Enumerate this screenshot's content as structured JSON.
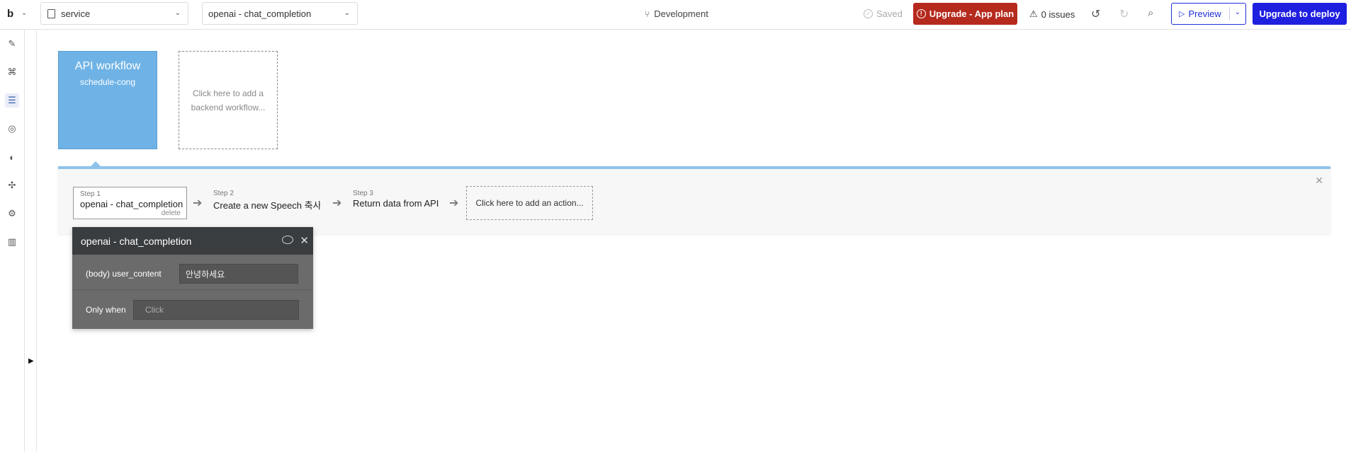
{
  "topbar": {
    "logo": "b",
    "page_dropdown": "service",
    "workflow_dropdown": "openai - chat_completion",
    "branch": "Development",
    "saved": "Saved",
    "upgrade_plan": "Upgrade - App plan",
    "issues": "0 issues",
    "preview": "Preview",
    "deploy": "Upgrade to deploy",
    "colors": {
      "upgrade_plan_bg": "#b52a1d",
      "deploy_bg": "#1f1fe0",
      "preview_border": "#1f2fd6"
    }
  },
  "sidebar": {
    "items": [
      {
        "icon": "pencil-icon",
        "glyph": "✎"
      },
      {
        "icon": "hierarchy-icon",
        "glyph": "⌘"
      },
      {
        "icon": "workflow-icon",
        "glyph": "☰"
      },
      {
        "icon": "database-icon",
        "glyph": "◎"
      },
      {
        "icon": "palette-icon",
        "glyph": "◐"
      },
      {
        "icon": "plugin-icon",
        "glyph": "✣"
      },
      {
        "icon": "settings-icon",
        "glyph": "⚙"
      },
      {
        "icon": "logs-icon",
        "glyph": "▥"
      }
    ]
  },
  "canvas": {
    "workflow_card": {
      "title": "API workflow",
      "subtitle": "schedule-cong"
    },
    "add_workflow": "Click here to add a backend workflow..."
  },
  "steps": [
    {
      "num": "Step 1",
      "label": "openai - chat_completion",
      "delete": "delete"
    },
    {
      "num": "Step 2",
      "label": "Create a new Speech 축사..."
    },
    {
      "num": "Step 3",
      "label": "Return data from API"
    }
  ],
  "add_action": "Click here to add an action...",
  "property_editor": {
    "title": "openai - chat_completion",
    "rows": [
      {
        "key": "(body) user_content",
        "value": "안녕하세요"
      },
      {
        "key": "Only when",
        "placeholder": "Click"
      }
    ]
  }
}
